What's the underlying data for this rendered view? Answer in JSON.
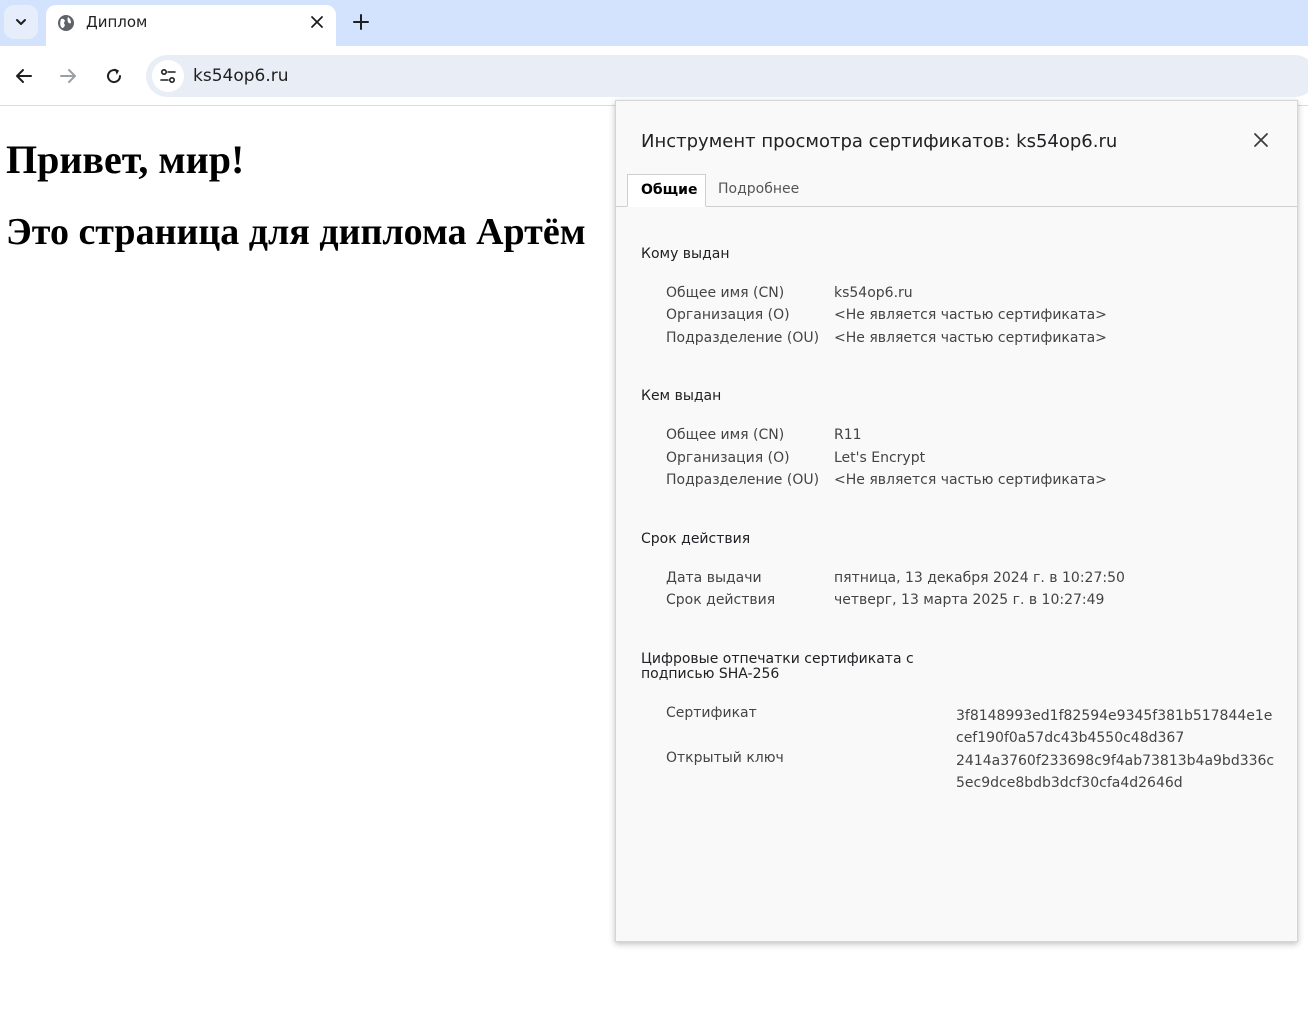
{
  "browser": {
    "tab": {
      "title": "Диплом"
    },
    "url": "ks54op6.ru"
  },
  "page": {
    "heading1": "Привет, мир!",
    "heading2": "Это страница для диплома Артём"
  },
  "dialog": {
    "title": "Инструмент просмотра сертификатов: ks54op6.ru",
    "tabs": [
      "Общие",
      "Подробнее"
    ],
    "issued_to": {
      "title": "Кому выдан",
      "rows": [
        {
          "label": "Общее имя (CN)",
          "value": "ks54op6.ru"
        },
        {
          "label": "Организация (O)",
          "value": "<Не является частью сертификата>"
        },
        {
          "label": "Подразделение (OU)",
          "value": "<Не является частью сертификата>"
        }
      ]
    },
    "issued_by": {
      "title": "Кем выдан",
      "rows": [
        {
          "label": "Общее имя (CN)",
          "value": "R11"
        },
        {
          "label": "Организация (O)",
          "value": "Let's Encrypt"
        },
        {
          "label": "Подразделение (OU)",
          "value": "<Не является частью сертификата>"
        }
      ]
    },
    "validity": {
      "title": "Срок действия",
      "rows": [
        {
          "label": "Дата выдачи",
          "value": "пятница, 13 декабря 2024 г. в 10:27:50"
        },
        {
          "label": "Срок действия",
          "value": "четверг, 13 марта 2025 г. в 10:27:49"
        }
      ]
    },
    "fingerprints": {
      "title_line1": "Цифровые отпечатки сертификата с",
      "title_line2": "подписью SHA-256",
      "rows": [
        {
          "label": "Сертификат",
          "value": "3f8148993ed1f82594e9345f381b517844e1ecef190f0a57dc43b4550c48d367"
        },
        {
          "label": "Открытый ключ",
          "value": "2414a3760f233698c9f4ab73813b4a9bd336c5ec9dce8bdb3dcf30cfa4d2646d"
        }
      ]
    }
  }
}
